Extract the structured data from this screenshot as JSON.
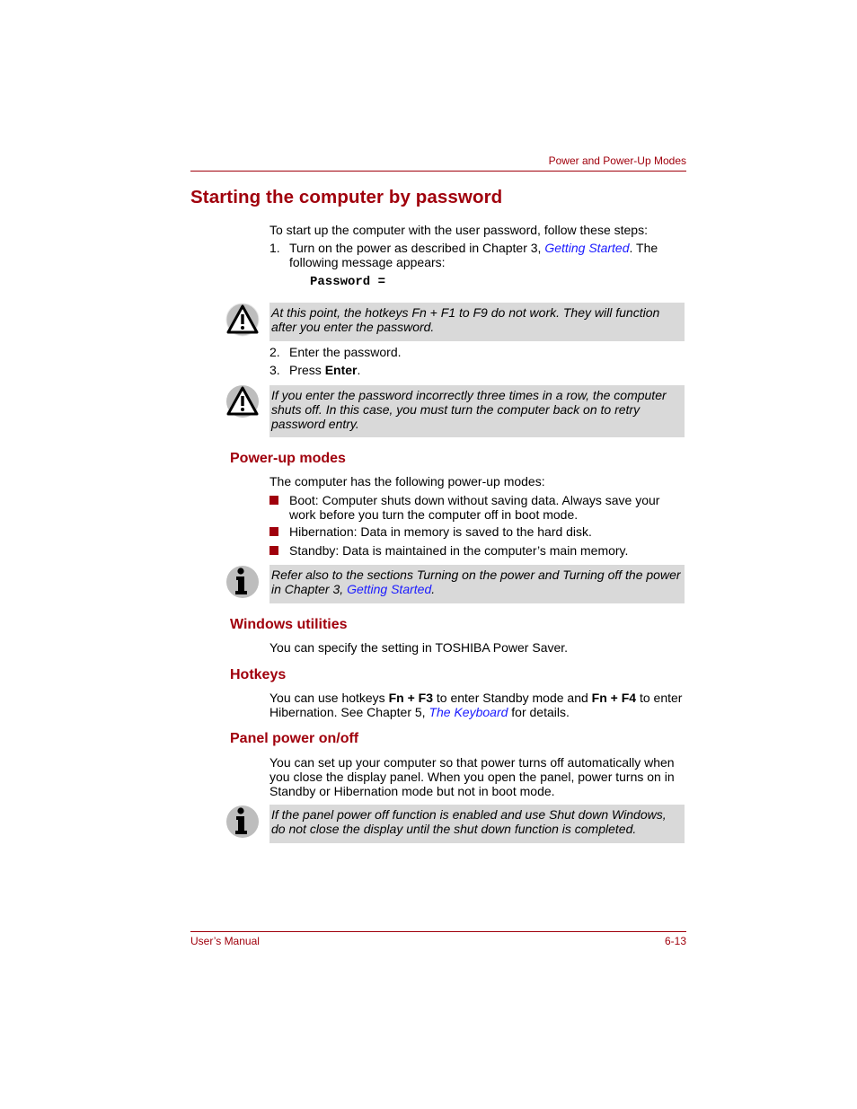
{
  "header": {
    "section": "Power and Power-Up Modes"
  },
  "title": "Starting the computer by password",
  "intro": "To start up the computer with the user password, follow these steps:",
  "steps": [
    {
      "num": "1.",
      "pre": "Turn on the power as described in Chapter 3, ",
      "link": "Getting Started",
      "post": ". The following message appears:"
    },
    {
      "num": "2.",
      "text": "Enter the password."
    },
    {
      "num": "3.",
      "pre": "Press ",
      "bold": "Enter",
      "post": "."
    }
  ],
  "password_prompt": "Password =",
  "cautions": [
    {
      "icon": "warning-icon",
      "text": "At this point, the hotkeys Fn + F1 to F9 do not work. They will function after you enter the password."
    },
    {
      "icon": "warning-icon",
      "text": "If you enter the password incorrectly three times in a row, the computer shuts off. In this case, you must turn the computer back on to retry password entry."
    }
  ],
  "power_up_modes": {
    "heading": "Power-up modes",
    "intro": "The computer has the following power-up modes:",
    "items": [
      "Boot: Computer shuts down without saving data. Always save your work before you turn the computer off in boot mode.",
      "Hibernation: Data in memory is saved to the hard disk.",
      "Standby: Data is maintained in the computer’s main memory."
    ],
    "note": {
      "icon": "info-icon",
      "pre": "Refer also to the sections Turning on the power and Turning off the power in Chapter 3, ",
      "link": "Getting Started",
      "post": "."
    }
  },
  "windows_utilities": {
    "heading": "Windows utilities",
    "text": "You can specify the setting in TOSHIBA Power Saver."
  },
  "hotkeys": {
    "heading": "Hotkeys",
    "t1": "You can use hotkeys ",
    "k1": "Fn + F3",
    "t2": " to enter Standby mode and ",
    "k2": "Fn + F4",
    "t3": " to enter Hibernation. See Chapter 5, ",
    "link": "The Keyboard",
    "t4": " for details."
  },
  "panel_power": {
    "heading": "Panel power on/off",
    "text": "You can set up your computer so that power turns off automatically when you close the display panel. When you open the panel, power turns on in Standby or Hibernation mode but not in boot mode.",
    "note": {
      "icon": "info-icon",
      "text": "If the panel power off function is enabled and use Shut down Windows, do not close the display until the shut down function is completed."
    }
  },
  "footer": {
    "left": "User’s Manual",
    "right": "6-13"
  },
  "colors": {
    "accent": "#a0000c",
    "link": "#1a1aff",
    "note_bg": "#d9d9d9"
  }
}
